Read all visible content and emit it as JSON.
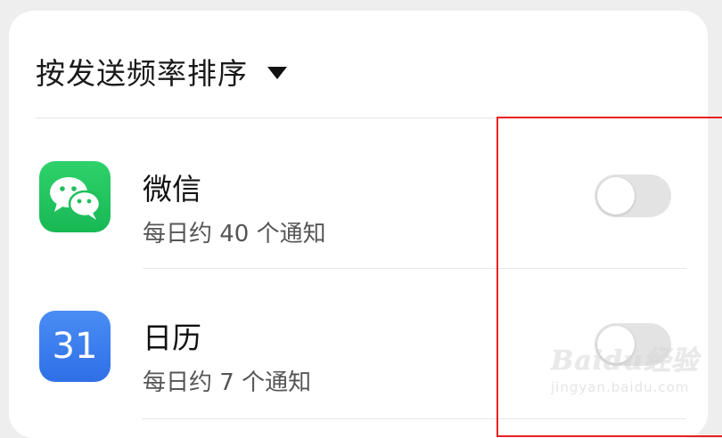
{
  "sort": {
    "label": "按发送频率排序",
    "caret_icon": "caret-down-icon"
  },
  "apps": [
    {
      "name": "微信",
      "subtitle": "每日约 40 个通知",
      "icon": "wechat-icon",
      "icon_color": "#1fc05c",
      "enabled": false
    },
    {
      "name": "日历",
      "subtitle": "每日约 7 个通知",
      "icon": "calendar-icon",
      "icon_text": "31",
      "icon_color": "#3a7ef0",
      "enabled": false
    }
  ],
  "highlight_color": "#e8211e",
  "watermark": {
    "logo": "Baidu经验",
    "url": "jingyan.baidu.com"
  }
}
